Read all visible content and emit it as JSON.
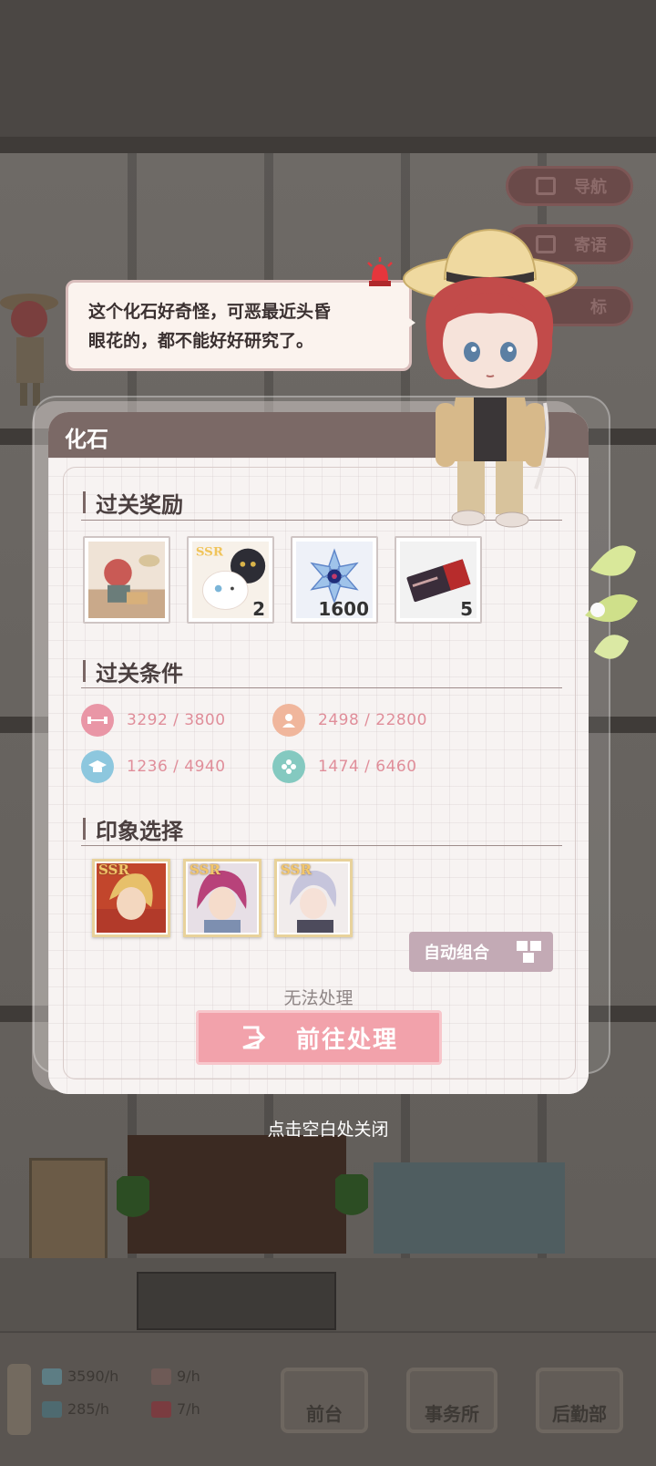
{
  "side_buttons": {
    "nav": "导航",
    "message": "寄语",
    "target": "标"
  },
  "speech": {
    "line1": "这个化石好奇怪，可恶最近头昏",
    "line2": "眼花的，都不能好好研究了。"
  },
  "panel": {
    "title": "化石",
    "sections": {
      "rewards": "过关奖励",
      "conditions": "过关条件",
      "impression": "印象选择"
    },
    "rewards": [
      {
        "name": "story-card-reward",
        "count": ""
      },
      {
        "name": "ssr-cat-card-reward",
        "count": "2"
      },
      {
        "name": "crystal-reward",
        "count": "1600"
      },
      {
        "name": "ticket-reward",
        "count": "5"
      }
    ],
    "conditions": [
      {
        "icon": "dumbbell-icon",
        "value": "3292 / 3800",
        "color": "#e996a6"
      },
      {
        "icon": "person-icon",
        "value": "2498 / 22800",
        "color": "#f0b69c"
      },
      {
        "icon": "graduation-cap-icon",
        "value": "1236 / 4940",
        "color": "#8dc7de"
      },
      {
        "icon": "flower-icon",
        "value": "1474 / 6460",
        "color": "#84c9c0"
      }
    ],
    "cards": [
      {
        "rarity": "SSR"
      },
      {
        "rarity": "SSR"
      },
      {
        "rarity": "SSR"
      }
    ],
    "auto_button": "自动组合",
    "status": "无法处理",
    "go_button": "前往处理"
  },
  "close_hint": "点击空白处关闭",
  "bottom": {
    "res1": "3590/h",
    "res2": "9/h",
    "res3": "285/h",
    "res4": "7/h",
    "nav": [
      "前台",
      "事务所",
      "后勤部"
    ]
  },
  "colors": {
    "accent_pink": "#f2a2ab",
    "header": "#7b6966"
  }
}
